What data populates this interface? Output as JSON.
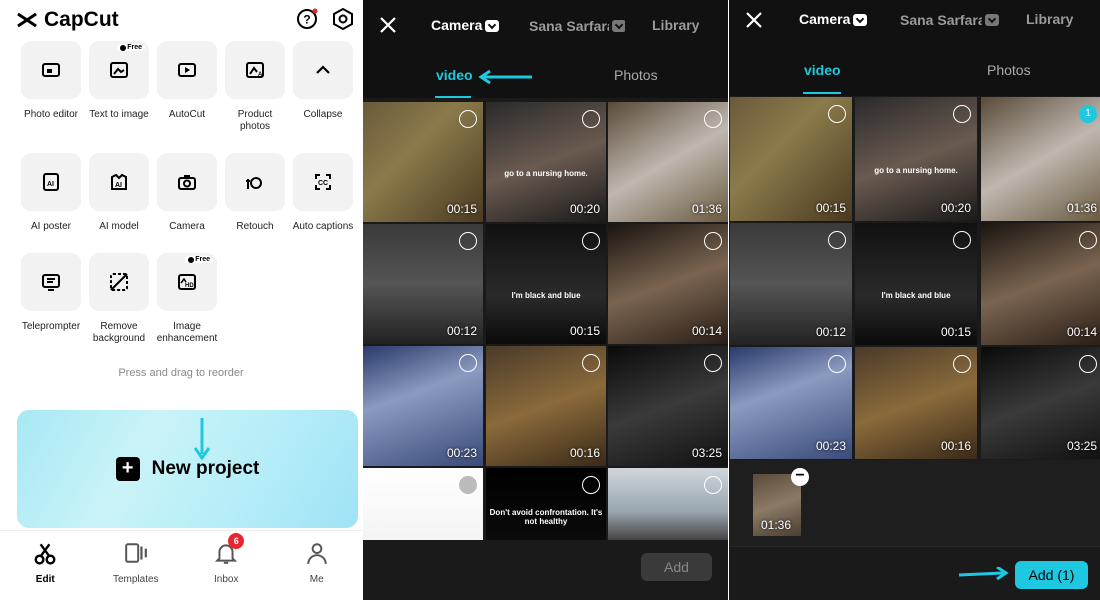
{
  "p1": {
    "app_name": "CapCut",
    "free_badge": "Free",
    "tools": [
      {
        "label": "Photo editor",
        "icon": "photo-editor-icon"
      },
      {
        "label": "Text to image",
        "icon": "text-to-image-icon",
        "free": true
      },
      {
        "label": "AutoCut",
        "icon": "autocut-icon"
      },
      {
        "label": "Product photos",
        "icon": "product-photos-icon"
      },
      {
        "label": "Collapse",
        "icon": "chevron-up-icon"
      },
      {
        "label": "AI poster",
        "icon": "ai-poster-icon"
      },
      {
        "label": "AI model",
        "icon": "ai-model-icon"
      },
      {
        "label": "Camera",
        "icon": "camera-icon"
      },
      {
        "label": "Retouch",
        "icon": "retouch-icon"
      },
      {
        "label": "Auto captions",
        "icon": "auto-captions-icon"
      },
      {
        "label": "Teleprompter",
        "icon": "teleprompter-icon"
      },
      {
        "label": "Remove background",
        "icon": "remove-background-icon"
      },
      {
        "label": "Image enhancement",
        "icon": "image-enhancement-icon",
        "free": true
      }
    ],
    "reorder_hint": "Press and drag to reorder",
    "new_project": "New project",
    "nav": [
      {
        "label": "Edit",
        "icon": "scissors-icon",
        "active": true
      },
      {
        "label": "Templates",
        "icon": "templates-icon"
      },
      {
        "label": "Inbox",
        "icon": "bell-icon",
        "badge": "6"
      },
      {
        "label": "Me",
        "icon": "person-icon"
      }
    ]
  },
  "picker": {
    "tabs": [
      "Camera",
      "Sana Sarfaraz",
      "Library"
    ],
    "subtabs": [
      "video",
      "Photos"
    ],
    "durations": [
      "00:15",
      "00:20",
      "01:36",
      "00:12",
      "00:15",
      "00:14",
      "00:23",
      "00:16",
      "03:25"
    ],
    "captions": [
      "go to a nursing home.",
      "I'm black and blue",
      "Don't avoid confrontation. It's not healthy"
    ],
    "selected_number": "1",
    "selected_thumb_duration": "01:36",
    "add_label": "Add",
    "add_selected_label": "Add (1)"
  },
  "colors": {
    "accent": "#1ec8e0",
    "badge": "#e8262e"
  }
}
